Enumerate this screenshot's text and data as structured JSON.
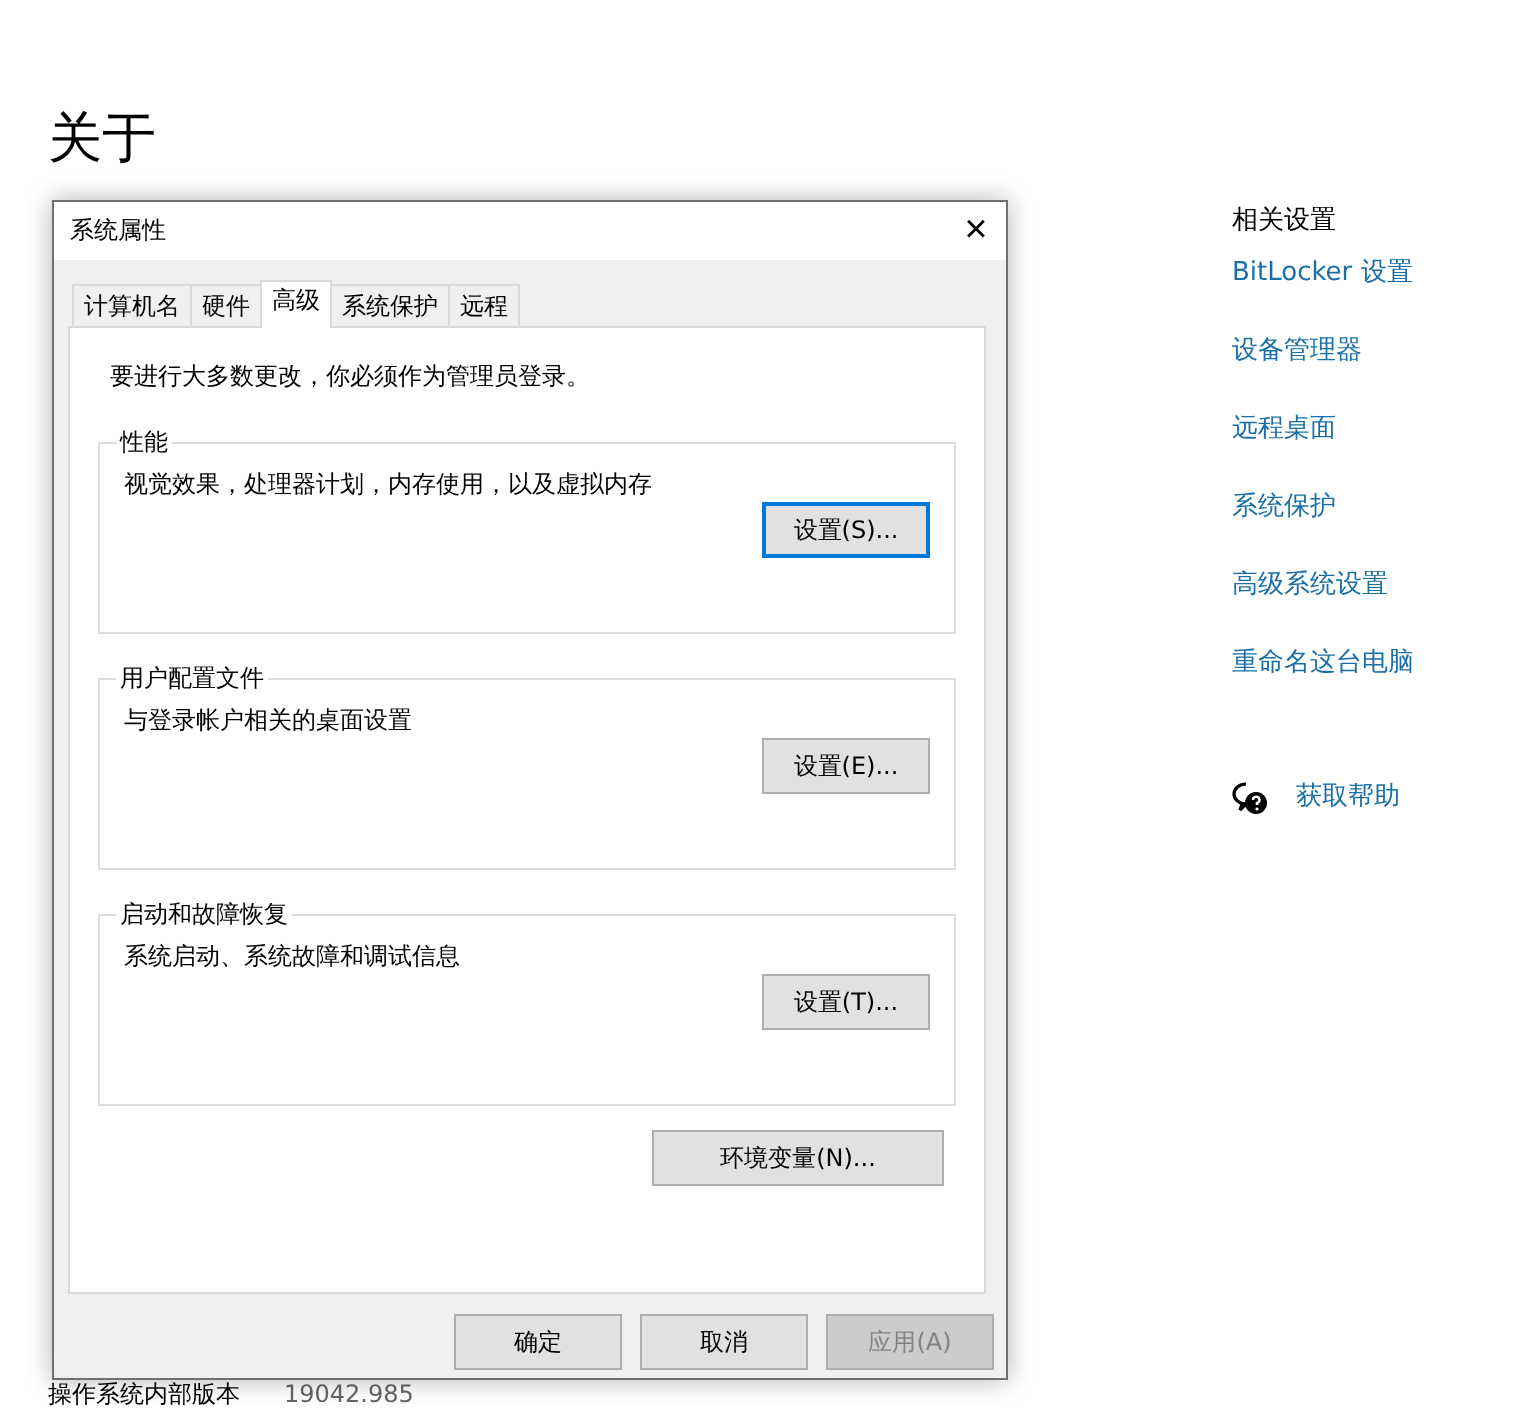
{
  "page": {
    "title": "关于",
    "bottom_row": {
      "label": "操作系统内部版本",
      "value": "19042.985"
    }
  },
  "related": {
    "heading": "相关设置",
    "links": [
      "BitLocker 设置",
      "设备管理器",
      "远程桌面",
      "系统保护",
      "高级系统设置",
      "重命名这台电脑"
    ],
    "help": "获取帮助"
  },
  "dialog": {
    "title": "系统属性",
    "close": "×",
    "tabs": [
      {
        "label": "计算机名",
        "selected": false
      },
      {
        "label": "硬件",
        "selected": false
      },
      {
        "label": "高级",
        "selected": true
      },
      {
        "label": "系统保护",
        "selected": false
      },
      {
        "label": "远程",
        "selected": false
      }
    ],
    "notice": "要进行大多数更改，你必须作为管理员登录。",
    "groups": [
      {
        "title": "性能",
        "description": "视觉效果，处理器计划，内存使用，以及虚拟内存",
        "button": {
          "label": "设置(S)...",
          "focused": true
        }
      },
      {
        "title": "用户配置文件",
        "description": "与登录帐户相关的桌面设置",
        "button": {
          "label": "设置(E)...",
          "focused": false
        }
      },
      {
        "title": "启动和故障恢复",
        "description": "系统启动、系统故障和调试信息",
        "button": {
          "label": "设置(T)...",
          "focused": false
        }
      }
    ],
    "env_button": "环境变量(N)...",
    "buttons": [
      {
        "label": "确定",
        "disabled": false
      },
      {
        "label": "取消",
        "disabled": false
      },
      {
        "label": "应用(A)",
        "disabled": true
      }
    ]
  }
}
